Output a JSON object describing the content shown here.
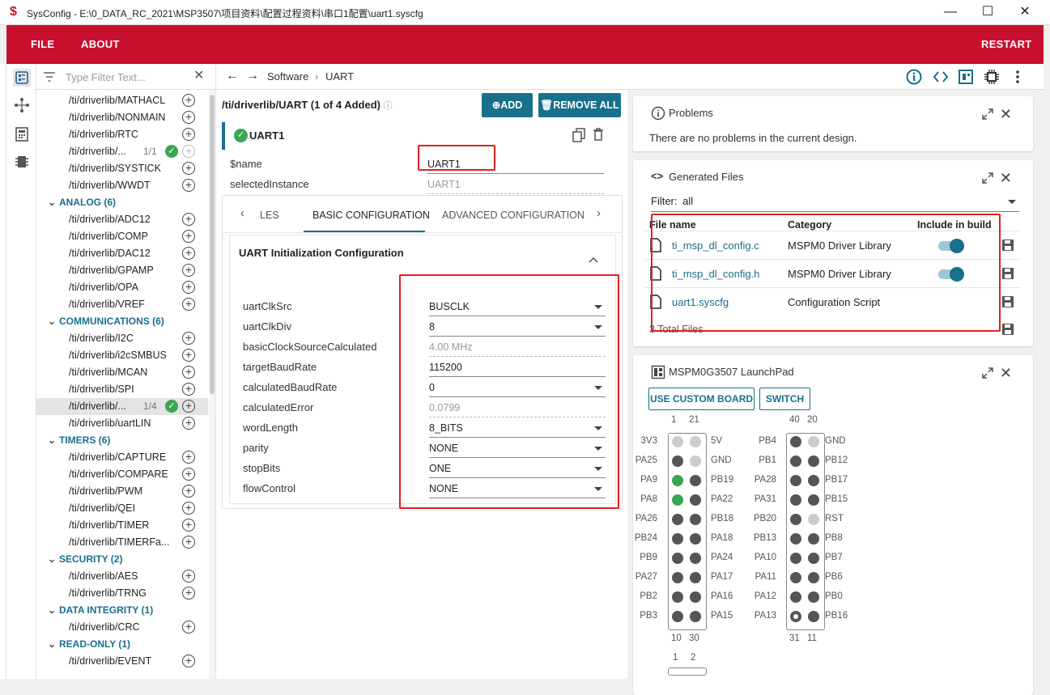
{
  "window": {
    "title": "SysConfig - E:\\0_DATA_RC_2021\\MSP3507\\项目资料\\配置过程资料\\串口1配置\\uart1.syscfg",
    "minimize": "—",
    "maximize": "☐",
    "close": "✕"
  },
  "menu": {
    "file": "FILE",
    "about": "ABOUT",
    "restart": "RESTART"
  },
  "filter": {
    "placeholder": "Type Filter Text..."
  },
  "tree": {
    "rows": [
      {
        "label": "/ti/driverlib/MATHACL"
      },
      {
        "label": "/ti/driverlib/NONMAIN"
      },
      {
        "label": "/ti/driverlib/RTC"
      },
      {
        "label": "/ti/driverlib/...",
        "count": "1/1"
      },
      {
        "label": "/ti/driverlib/SYSTICK"
      },
      {
        "label": "/ti/driverlib/WWDT"
      },
      {
        "cat": "ANALOG (6)"
      },
      {
        "label": "/ti/driverlib/ADC12"
      },
      {
        "label": "/ti/driverlib/COMP"
      },
      {
        "label": "/ti/driverlib/DAC12"
      },
      {
        "label": "/ti/driverlib/GPAMP"
      },
      {
        "label": "/ti/driverlib/OPA"
      },
      {
        "label": "/ti/driverlib/VREF"
      },
      {
        "cat": "COMMUNICATIONS (6)"
      },
      {
        "label": "/ti/driverlib/I2C"
      },
      {
        "label": "/ti/driverlib/i2cSMBUS"
      },
      {
        "label": "/ti/driverlib/MCAN"
      },
      {
        "label": "/ti/driverlib/SPI"
      },
      {
        "label": "/ti/driverlib/...",
        "count": "1/4"
      },
      {
        "label": "/ti/driverlib/uartLIN"
      },
      {
        "cat": "TIMERS (6)"
      },
      {
        "label": "/ti/driverlib/CAPTURE"
      },
      {
        "label": "/ti/driverlib/COMPARE"
      },
      {
        "label": "/ti/driverlib/PWM"
      },
      {
        "label": "/ti/driverlib/QEI"
      },
      {
        "label": "/ti/driverlib/TIMER"
      },
      {
        "label": "/ti/driverlib/TIMERFa..."
      },
      {
        "cat": "SECURITY (2)"
      },
      {
        "label": "/ti/driverlib/AES"
      },
      {
        "label": "/ti/driverlib/TRNG"
      },
      {
        "cat": "DATA INTEGRITY (1)"
      },
      {
        "label": "/ti/driverlib/CRC"
      },
      {
        "cat": "READ-ONLY (1)"
      },
      {
        "label": "/ti/driverlib/EVENT"
      }
    ]
  },
  "breadcrumb": {
    "root": "Software",
    "sep": "›",
    "leaf": "UART"
  },
  "module": {
    "header": "/ti/driverlib/UART (1 of 4 Added)",
    "add": "ADD",
    "remove_all": "REMOVE ALL",
    "instance": "UART1"
  },
  "fields": {
    "name_label": "$name",
    "name_value": "UART1",
    "sel_label": "selectedInstance",
    "sel_value": "UART1"
  },
  "tabs": {
    "t1": "LES",
    "t2": "BASIC CONFIGURATION",
    "t3": "ADVANCED CONFIGURATION"
  },
  "group": {
    "title": "UART Initialization Configuration"
  },
  "config": [
    {
      "label": "uartClkSrc",
      "value": "BUSCLK",
      "dd": true
    },
    {
      "label": "uartClkDiv",
      "value": "8",
      "dd": true
    },
    {
      "label": "basicClockSourceCalculated",
      "value": "4.00 MHz",
      "dis": true
    },
    {
      "label": "targetBaudRate",
      "value": "115200"
    },
    {
      "label": "calculatedBaudRate",
      "value": "0",
      "dd": true
    },
    {
      "label": "calculatedError",
      "value": "0.0799",
      "dis": true
    },
    {
      "label": "wordLength",
      "value": "8_BITS",
      "dd": true
    },
    {
      "label": "parity",
      "value": "NONE",
      "dd": true
    },
    {
      "label": "stopBits",
      "value": "ONE",
      "dd": true
    },
    {
      "label": "flowControl",
      "value": "NONE",
      "dd": true
    }
  ],
  "problems": {
    "title": "Problems",
    "text": "There are no problems in the current design."
  },
  "generated": {
    "title": "Generated Files",
    "filter_label": "Filter:",
    "filter_value": "all",
    "headers": {
      "name": "File name",
      "category": "Category",
      "include": "Include in build"
    },
    "files": [
      {
        "name": "ti_msp_dl_config.c",
        "category": "MSPM0 Driver Library",
        "toggle": true
      },
      {
        "name": "ti_msp_dl_config.h",
        "category": "MSPM0 Driver Library",
        "toggle": true
      },
      {
        "name": "uart1.syscfg",
        "category": "Configuration Script",
        "toggle": false
      }
    ],
    "total": "3 Total Files"
  },
  "board": {
    "title": "MSPM0G3507 LaunchPad",
    "custom": "USE CUSTOM BOARD",
    "switch": "SWITCH",
    "left": {
      "top": [
        "1",
        "21"
      ],
      "bottom": [
        "10",
        "30"
      ],
      "rows": [
        [
          "3V3",
          "5V",
          "lt",
          "lt"
        ],
        [
          "PA25",
          "GND",
          "d",
          "lt"
        ],
        [
          "PA9",
          "PB19",
          "g",
          "d"
        ],
        [
          "PA8",
          "PA22",
          "g",
          "d"
        ],
        [
          "PA26",
          "PB18",
          "d",
          "d"
        ],
        [
          "PB24",
          "PA18",
          "d",
          "d"
        ],
        [
          "PB9",
          "PA24",
          "d",
          "d"
        ],
        [
          "PA27",
          "PA17",
          "d",
          "d"
        ],
        [
          "PB2",
          "PA16",
          "d",
          "d"
        ],
        [
          "PB3",
          "PA15",
          "d",
          "d"
        ]
      ]
    },
    "right": {
      "top": [
        "40",
        "20"
      ],
      "bottom": [
        "31",
        "11"
      ],
      "rows": [
        [
          "PB4",
          "GND",
          "d",
          "lt"
        ],
        [
          "PB1",
          "PB12",
          "d",
          "d"
        ],
        [
          "PA28",
          "PB17",
          "d",
          "d"
        ],
        [
          "PA31",
          "PB15",
          "d",
          "d"
        ],
        [
          "PB20",
          "RST",
          "d",
          "lt"
        ],
        [
          "PB13",
          "PB8",
          "d",
          "d"
        ],
        [
          "PA10",
          "PB7",
          "d",
          "d"
        ],
        [
          "PA11",
          "PB6",
          "d",
          "d"
        ],
        [
          "PA12",
          "PB0",
          "d",
          "d"
        ],
        [
          "PA13",
          "PB16",
          "o",
          "d"
        ]
      ]
    },
    "third_top": [
      "1",
      "2"
    ]
  }
}
